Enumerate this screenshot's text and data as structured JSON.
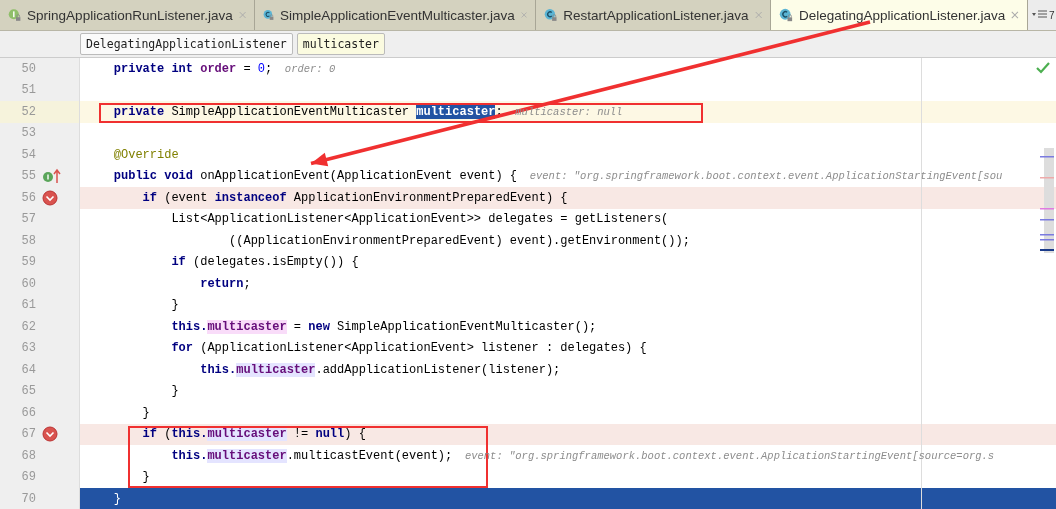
{
  "tabs": [
    {
      "label": "SpringApplicationRunListener.java",
      "kind": "interface",
      "selected": false
    },
    {
      "label": "SimpleApplicationEventMulticaster.java",
      "kind": "class",
      "selected": false
    },
    {
      "label": "RestartApplicationListener.java",
      "kind": "class",
      "selected": false
    },
    {
      "label": "DelegatingApplicationListener.java",
      "kind": "class",
      "selected": true,
      "arrow_source": true
    }
  ],
  "tab_overflow": {
    "count": "7"
  },
  "breadcrumbs": [
    {
      "label": "DelegatingApplicationListener",
      "selected": false
    },
    {
      "label": "multicaster",
      "selected": true
    }
  ],
  "lines": [
    {
      "number": "50",
      "tokens": [
        {
          "kind": "kw",
          "text": "    private int "
        },
        {
          "kind": "field",
          "text": "order"
        },
        {
          "kind": "plain",
          "text": " = "
        },
        {
          "kind": "num",
          "text": "0"
        },
        {
          "kind": "plain",
          "text": ";"
        },
        {
          "kind": "hint",
          "text": "  order: 0"
        }
      ]
    },
    {
      "number": "51"
    },
    {
      "number": "52",
      "caret": true,
      "boxed": true,
      "tokens": [
        {
          "kind": "kw",
          "text": "    private "
        },
        {
          "kind": "plain",
          "text": "SimpleApplicationEventMulticaster "
        },
        {
          "kind": "selection",
          "text": "multicaster"
        },
        {
          "kind": "plain",
          "text": ";"
        },
        {
          "kind": "hint",
          "text": "  multicaster: null"
        }
      ]
    },
    {
      "number": "53"
    },
    {
      "number": "54",
      "tokens": [
        {
          "kind": "annotation",
          "text": "    @Override"
        }
      ]
    },
    {
      "number": "55",
      "implements_marker": true,
      "arrow_target": true,
      "tokens": [
        {
          "kind": "kw",
          "text": "    public void "
        },
        {
          "kind": "plain",
          "text": "onApplicationEvent(ApplicationEvent event) {"
        },
        {
          "kind": "hint",
          "text": "  event: \"org.springframework.boot.context.event.ApplicationStartingEvent[sou"
        }
      ]
    },
    {
      "number": "56",
      "breakpoint": true,
      "tokens": [
        {
          "kind": "kw",
          "text": "        if "
        },
        {
          "kind": "plain",
          "text": "(event "
        },
        {
          "kind": "kw",
          "text": "instanceof "
        },
        {
          "kind": "plain",
          "text": "ApplicationEnvironmentPreparedEvent) {"
        }
      ]
    },
    {
      "number": "57",
      "tokens": [
        {
          "kind": "plain",
          "text": "            List<ApplicationListener<ApplicationEvent>> delegates = getListeners("
        }
      ]
    },
    {
      "number": "58",
      "tokens": [
        {
          "kind": "plain",
          "text": "                    ((ApplicationEnvironmentPreparedEvent) event).getEnvironment());"
        }
      ]
    },
    {
      "number": "59",
      "tokens": [
        {
          "kind": "kw",
          "text": "            if "
        },
        {
          "kind": "plain",
          "text": "(delegates.isEmpty()) {"
        }
      ]
    },
    {
      "number": "60",
      "tokens": [
        {
          "kind": "kw",
          "text": "                return"
        },
        {
          "kind": "plain",
          "text": ";"
        }
      ]
    },
    {
      "number": "61",
      "tokens": [
        {
          "kind": "plain",
          "text": "            }"
        }
      ]
    },
    {
      "number": "62",
      "tokens": [
        {
          "kind": "kw",
          "text": "            this."
        },
        {
          "kind": "field-write",
          "text": "multicaster"
        },
        {
          "kind": "plain",
          "text": " = "
        },
        {
          "kind": "kw",
          "text": "new "
        },
        {
          "kind": "plain",
          "text": "SimpleApplicationEventMulticaster();"
        }
      ]
    },
    {
      "number": "63",
      "tokens": [
        {
          "kind": "kw",
          "text": "            for "
        },
        {
          "kind": "plain",
          "text": "(ApplicationListener<ApplicationEvent> listener : delegates) {"
        }
      ]
    },
    {
      "number": "64",
      "tokens": [
        {
          "kind": "kw",
          "text": "                this."
        },
        {
          "kind": "field-read",
          "text": "multicaster"
        },
        {
          "kind": "plain",
          "text": ".addApplicationListener(listener);"
        }
      ]
    },
    {
      "number": "65",
      "tokens": [
        {
          "kind": "plain",
          "text": "            }"
        }
      ]
    },
    {
      "number": "66",
      "tokens": [
        {
          "kind": "plain",
          "text": "        }"
        }
      ]
    },
    {
      "number": "67",
      "breakpoint": true,
      "boxed": true,
      "tokens": [
        {
          "kind": "kw",
          "text": "        if "
        },
        {
          "kind": "plain",
          "text": "("
        },
        {
          "kind": "kw",
          "text": "this."
        },
        {
          "kind": "field-read",
          "text": "multicaster"
        },
        {
          "kind": "plain",
          "text": " != "
        },
        {
          "kind": "kw",
          "text": "null"
        },
        {
          "kind": "plain",
          "text": ") {"
        }
      ]
    },
    {
      "number": "68",
      "boxed": true,
      "tokens": [
        {
          "kind": "kw",
          "text": "            this."
        },
        {
          "kind": "field-read",
          "text": "multicaster"
        },
        {
          "kind": "plain",
          "text": ".multicastEvent(event);"
        },
        {
          "kind": "hint",
          "text": "  event: \"org.springframework.boot.context.event.ApplicationStartingEvent[source=org.s"
        }
      ]
    },
    {
      "number": "69",
      "boxed": true,
      "tokens": [
        {
          "kind": "plain",
          "text": "        }"
        }
      ]
    },
    {
      "number": "70",
      "execution": true,
      "tokens": [
        {
          "kind": "plain",
          "text": "    }"
        }
      ]
    }
  ]
}
